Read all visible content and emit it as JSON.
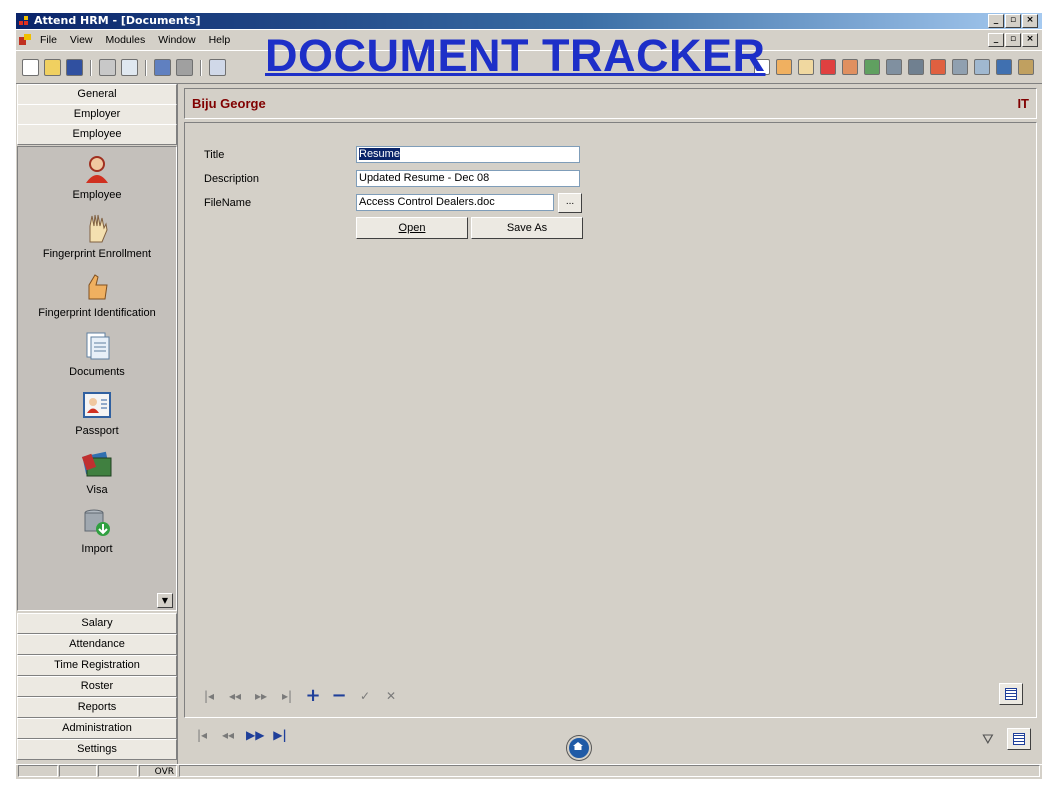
{
  "window": {
    "title": "Attend HRM - [Documents]",
    "controls": [
      "_",
      "▫",
      "×"
    ]
  },
  "menubar": {
    "items": [
      "File",
      "View",
      "Modules",
      "Window",
      "Help"
    ]
  },
  "banner": {
    "text": "DOCUMENT TRACKER"
  },
  "sidebar": {
    "top_buttons": [
      "General",
      "Employer",
      "Employee"
    ],
    "items": [
      {
        "label": "Employee",
        "icon": "employee-icon"
      },
      {
        "label": "Fingerprint Enrollment",
        "icon": "hand-icon"
      },
      {
        "label": "Fingerprint Identification",
        "icon": "thumb-icon"
      },
      {
        "label": "Documents",
        "icon": "documents-icon"
      },
      {
        "label": "Passport",
        "icon": "passport-icon"
      },
      {
        "label": "Visa",
        "icon": "visa-icon"
      },
      {
        "label": "Import",
        "icon": "import-icon"
      }
    ],
    "bottom_buttons": [
      "Salary",
      "Attendance",
      "Time Registration",
      "Roster",
      "Reports",
      "Administration",
      "Settings"
    ]
  },
  "header": {
    "employee_name": "Biju George",
    "department": "IT"
  },
  "form": {
    "title_label": "Title",
    "title_value": "Resume",
    "description_label": "Description",
    "description_value": "Updated Resume - Dec 08",
    "filename_label": "FileName",
    "filename_value": "Access Control Dealers.doc",
    "browse_label": "...",
    "open_label": "Open",
    "saveas_label": "Save As"
  },
  "record_nav": {
    "glyphs": [
      "|◂",
      "◂◂",
      "▸▸",
      "▸|",
      "+",
      "−",
      "✓",
      "✕"
    ]
  },
  "page_nav": {
    "glyphs": [
      "|◂",
      "◂◂",
      "▶▶",
      "▶|"
    ]
  },
  "statusbar": {
    "ovr": "OVR"
  },
  "colors": {
    "title_grad_start": "#0a246a",
    "banner": "#1d2fc8",
    "header_text": "#800000"
  }
}
